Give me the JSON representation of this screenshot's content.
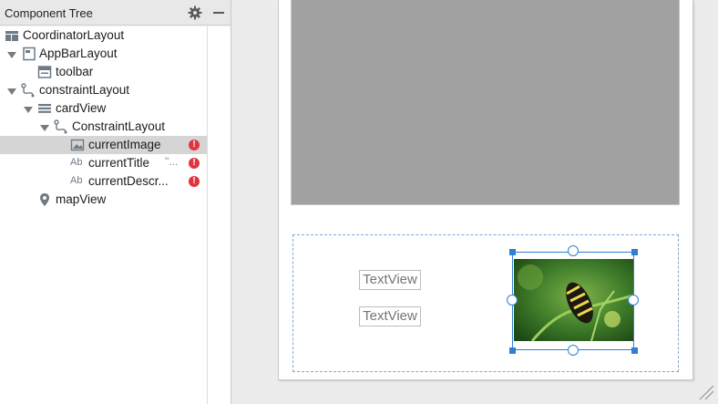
{
  "panel": {
    "title": "Component Tree"
  },
  "tree": {
    "items": [
      {
        "label": "CoordinatorLayout",
        "icon": "coordinator-layout-icon"
      },
      {
        "label": "AppBarLayout",
        "icon": "appbar-layout-icon",
        "expanded": true
      },
      {
        "label": "toolbar",
        "icon": "toolbar-icon"
      },
      {
        "label": "constraintLayout",
        "icon": "constraint-layout-icon",
        "expanded": true
      },
      {
        "label": "cardView",
        "icon": "cardview-icon",
        "expanded": true
      },
      {
        "label": "ConstraintLayout",
        "icon": "constraint-layout-icon",
        "expanded": true
      },
      {
        "label": "currentImage",
        "icon": "image-view-icon",
        "selected": true,
        "error": true
      },
      {
        "label": "currentTitle",
        "icon": "textview-icon",
        "hint": "\"...",
        "error": true
      },
      {
        "label": "currentDescr...",
        "icon": "textview-icon",
        "error": true
      },
      {
        "label": "mapView",
        "icon": "map-pin-icon"
      }
    ]
  },
  "design": {
    "textview1": "TextView",
    "textview2": "TextView"
  },
  "colors": {
    "selection": "#2f80d0",
    "error": "#e0353e",
    "placeholder_gray": "#a1a1a1"
  }
}
